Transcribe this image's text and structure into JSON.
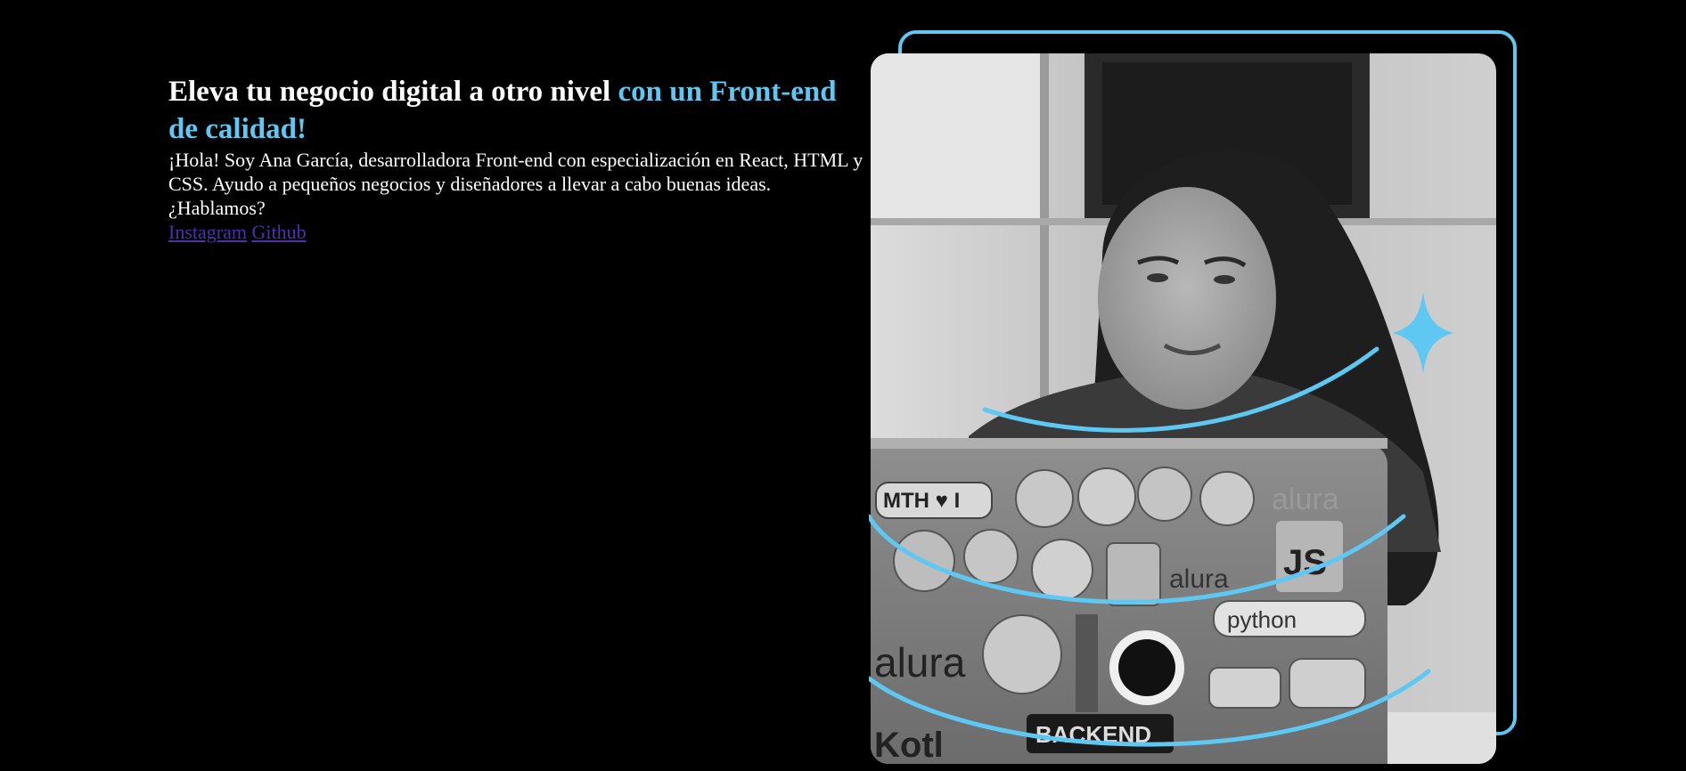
{
  "hero": {
    "headline_main": "Eleva tu negocio digital a otro nivel ",
    "headline_accent": "con un Front-end de calidad!",
    "bio": "¡Hola! Soy Ana García, desarrolladora Front-end con especialización en React, HTML y CSS. Ayudo a pequeños negocios y diseñadores a llevar a cabo buenas ideas. ¿Hablamos?",
    "image_icon": "star-sparkle-icon"
  },
  "links": {
    "instagram": "Instagram",
    "github": "Github"
  },
  "photo_stickers": {
    "mth": "MTH ♥ I",
    "alura_1": "alura",
    "js": "JS",
    "alura_2": "alura",
    "python": "python",
    "alura_3": "alura",
    "backend": "BACKEND",
    "kotlin": "Kotl"
  },
  "colors": {
    "background": "#000000",
    "text": "#ffffff",
    "accent": "#5ec8f2",
    "link": "#4f2fb0"
  }
}
